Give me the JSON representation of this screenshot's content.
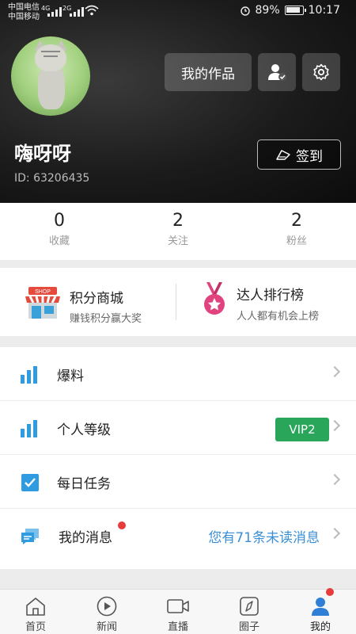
{
  "status_bar": {
    "carrier1": "中国电信",
    "carrier2": "中国移动",
    "net1": "4G",
    "net2": "2G",
    "battery": "89%",
    "time": "10:17"
  },
  "profile": {
    "username": "嗨呀呀",
    "user_id": "ID: 63206435",
    "works_button": "我的作品",
    "user_icon": "user-check-icon",
    "settings_icon": "gear-icon",
    "signin_button": "签到"
  },
  "stats": [
    {
      "value": "0",
      "label": "收藏"
    },
    {
      "value": "2",
      "label": "关注"
    },
    {
      "value": "2",
      "label": "粉丝"
    }
  ],
  "features": {
    "shop": {
      "title": "积分商城",
      "subtitle": "赚钱积分赢大奖",
      "sign": "SHOP"
    },
    "ranking": {
      "title": "达人排行榜",
      "subtitle": "人人都有机会上榜"
    }
  },
  "menu": [
    {
      "label": "爆料",
      "icon": "bar-chart-icon"
    },
    {
      "label": "个人等级",
      "icon": "bar-chart-icon",
      "badge": "VIP2"
    },
    {
      "label": "每日任务",
      "icon": "checkbox-icon"
    },
    {
      "label": "我的消息",
      "icon": "chat-icon",
      "info": "您有71条未读消息"
    }
  ],
  "tabs": [
    {
      "label": "首页",
      "icon": "home-icon"
    },
    {
      "label": "新闻",
      "icon": "play-icon"
    },
    {
      "label": "直播",
      "icon": "video-camera-icon"
    },
    {
      "label": "圈子",
      "icon": "compass-icon"
    },
    {
      "label": "我的",
      "icon": "profile-icon",
      "active": true
    }
  ],
  "colors": {
    "accent_blue": "#2f9be0",
    "vip_green": "#29a65a",
    "notice_red": "#e63c3c",
    "link_blue": "#3a8fd6"
  }
}
